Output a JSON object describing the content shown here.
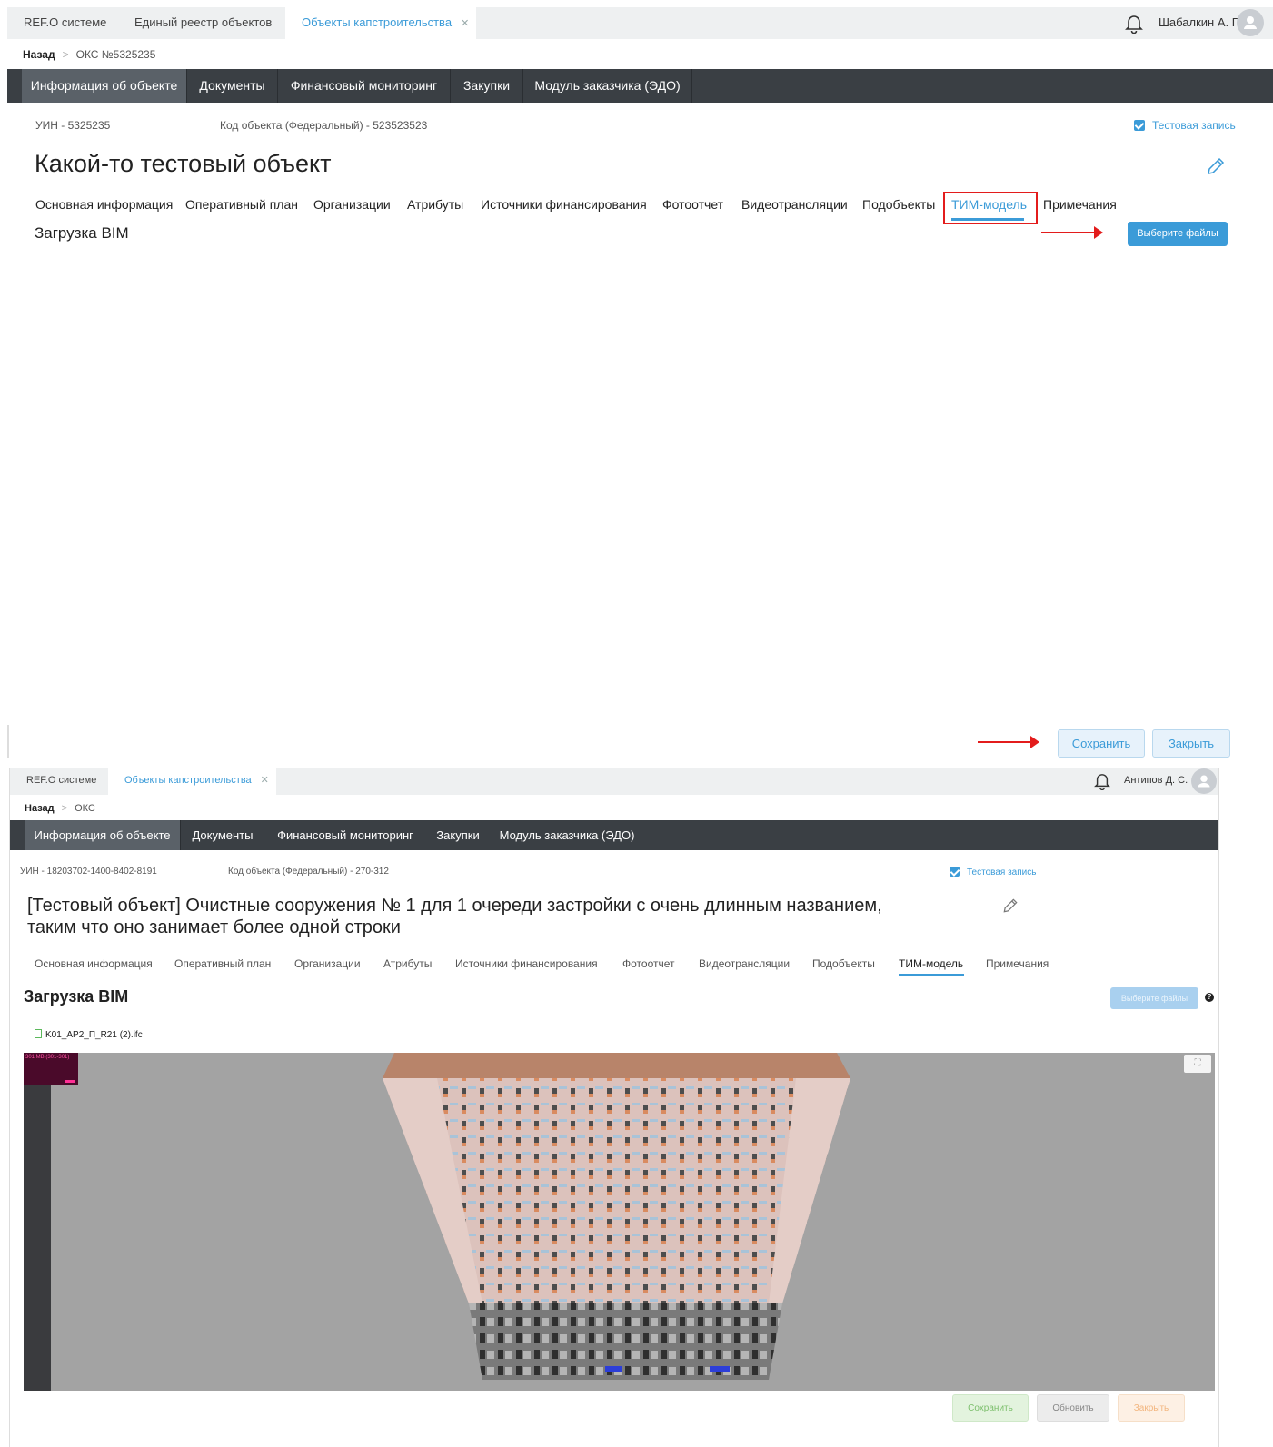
{
  "top": {
    "tabs": [
      "REF.O системе",
      "Единый реестр объектов",
      "Объекты капстроительства"
    ],
    "user": "Шабалкин А. Г.",
    "breadcrumb": {
      "back": "Назад",
      "current": "ОКС №5325235"
    },
    "nav": [
      "Информация об объекте",
      "Документы",
      "Финансовый мониторинг",
      "Закупки",
      "Модуль заказчика (ЭДО)"
    ],
    "uin": "УИН - 5325235",
    "code": "Код объекта (Федеральный) - 523523523",
    "test_label": "Тестовая запись",
    "title": "Какой-то тестовый объект",
    "subtabs": [
      "Основная информация",
      "Оперативный план",
      "Организации",
      "Атрибуты",
      "Источники финансирования",
      "Фотоотчет",
      "Видеотрансляции",
      "Подобъекты",
      "ТИМ-модель",
      "Примечания"
    ],
    "selected_subtab": "ТИМ-модель",
    "section": "Загрузка BIM",
    "choose_files": "Выберите файлы",
    "save": "Сохранить",
    "close": "Закрыть"
  },
  "bottom": {
    "tabs": [
      "REF.O системе",
      "Объекты капстроительства"
    ],
    "user": "Антипов Д. С.",
    "breadcrumb": {
      "back": "Назад",
      "current": "ОКС"
    },
    "nav": [
      "Информация об объекте",
      "Документы",
      "Финансовый мониторинг",
      "Закупки",
      "Модуль заказчика (ЭДО)"
    ],
    "uin": "УИН - 18203702-1400-8402-8191",
    "code": "Код объекта (Федеральный) -  270-312",
    "test_label": "Тестовая запись",
    "title_line1": "[Тестовый объект] Очистные сооружения № 1 для 1 очереди застройки с очень длинным названием,",
    "title_line2": "таким что оно занимает более одной строки",
    "subtabs": [
      "Основная информация",
      "Оперативный план",
      "Организации",
      "Атрибуты",
      "Источники финансирования",
      "Фотоотчет",
      "Видеотрансляции",
      "Подобъекты",
      "ТИМ-модель",
      "Примечания"
    ],
    "selected_subtab": "ТИМ-модель",
    "section": "Загрузка BIM",
    "choose_files": "Выберите файлы",
    "file_name": "K01_AP2_П_R21 (2).ifc",
    "stats": "301 MB (301-301)",
    "save": "Сохранить",
    "refresh": "Обновить",
    "close": "Закрыть"
  },
  "colors": {
    "accent": "#3b9bd8",
    "nav_bg": "#3a3f44",
    "nav_active": "#5a6168",
    "highlight": "#e31c1c",
    "facade": "#dfc3bd"
  },
  "icons": [
    "bell-icon",
    "user-avatar-icon",
    "pencil-icon",
    "file-icon",
    "help-icon",
    "fullscreen-icon",
    "close-icon",
    "arrow-icon"
  ]
}
